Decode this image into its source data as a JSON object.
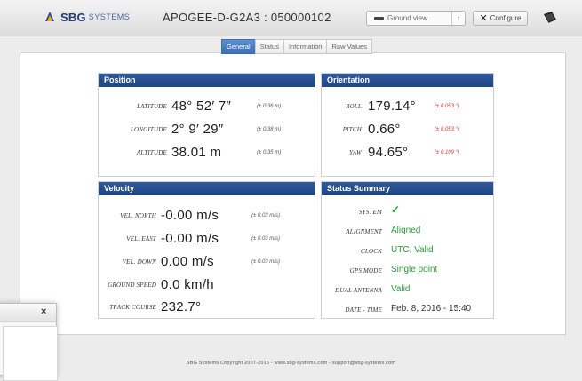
{
  "header": {
    "logo_text": "SBG",
    "logo_sub": "SYSTEMS",
    "device_title": "APOGEE-D-G2A3 : 050000102",
    "view_select": {
      "value": "Ground view",
      "icon": "vehicle-icon"
    },
    "configure_label": "Configure",
    "help_icon": "book-icon"
  },
  "tabs": [
    {
      "label": "General",
      "active": true
    },
    {
      "label": "Status",
      "active": false
    },
    {
      "label": "Information",
      "active": false
    },
    {
      "label": "Raw Values",
      "active": false
    }
  ],
  "position": {
    "title": "Position",
    "rows": [
      {
        "label": "Latitude",
        "value": "48° 52′ 7″",
        "accuracy": "(± 0.36 m)"
      },
      {
        "label": "Longitude",
        "value": "2° 9′ 29″",
        "accuracy": "(± 0.38 m)"
      },
      {
        "label": "Altitude",
        "value": "38.01 m",
        "accuracy": "(± 0.35 m)"
      }
    ]
  },
  "orientation": {
    "title": "Orientation",
    "rows": [
      {
        "label": "Roll",
        "value": "179.14°",
        "accuracy": "(± 0.053 °)"
      },
      {
        "label": "Pitch",
        "value": "0.66°",
        "accuracy": "(± 0.053 °)"
      },
      {
        "label": "Yaw",
        "value": "94.65°",
        "accuracy": "(± 0.109 °)"
      }
    ]
  },
  "velocity": {
    "title": "Velocity",
    "rows": [
      {
        "label": "Vel. North",
        "value": "-0.00 m/s",
        "accuracy": "(± 0.03 m/s)"
      },
      {
        "label": "Vel. East",
        "value": "-0.00 m/s",
        "accuracy": "(± 0.03 m/s)"
      },
      {
        "label": "Vel. Down",
        "value": "0.00 m/s",
        "accuracy": "(± 0.03 m/s)"
      },
      {
        "label": "Ground Speed",
        "value": "0.0 km/h",
        "accuracy": ""
      },
      {
        "label": "Track Course",
        "value": "232.7°",
        "accuracy": ""
      }
    ]
  },
  "status": {
    "title": "Status Summary",
    "rows": [
      {
        "label": "System",
        "value": "✓"
      },
      {
        "label": "Alignment",
        "value": "Aligned"
      },
      {
        "label": "Clock",
        "value": "UTC, Valid"
      },
      {
        "label": "GPS Mode",
        "value": "Single point"
      },
      {
        "label": "Dual Antenna",
        "value": "Valid"
      },
      {
        "label": "Date - Time",
        "value": "Feb. 8, 2016 - 15:40"
      }
    ]
  },
  "dialog": {
    "close_label": "×"
  },
  "footer": {
    "text": "SBG Systems Copyright 2007-2015 - www.sbg-systems.com - support@sbg-systems.com"
  },
  "colors": {
    "panel_header": "#2f5a9d",
    "tab_active": "#3a6db6",
    "status_ok": "#2c9b3c",
    "accuracy_warn": "#d23b3b"
  }
}
